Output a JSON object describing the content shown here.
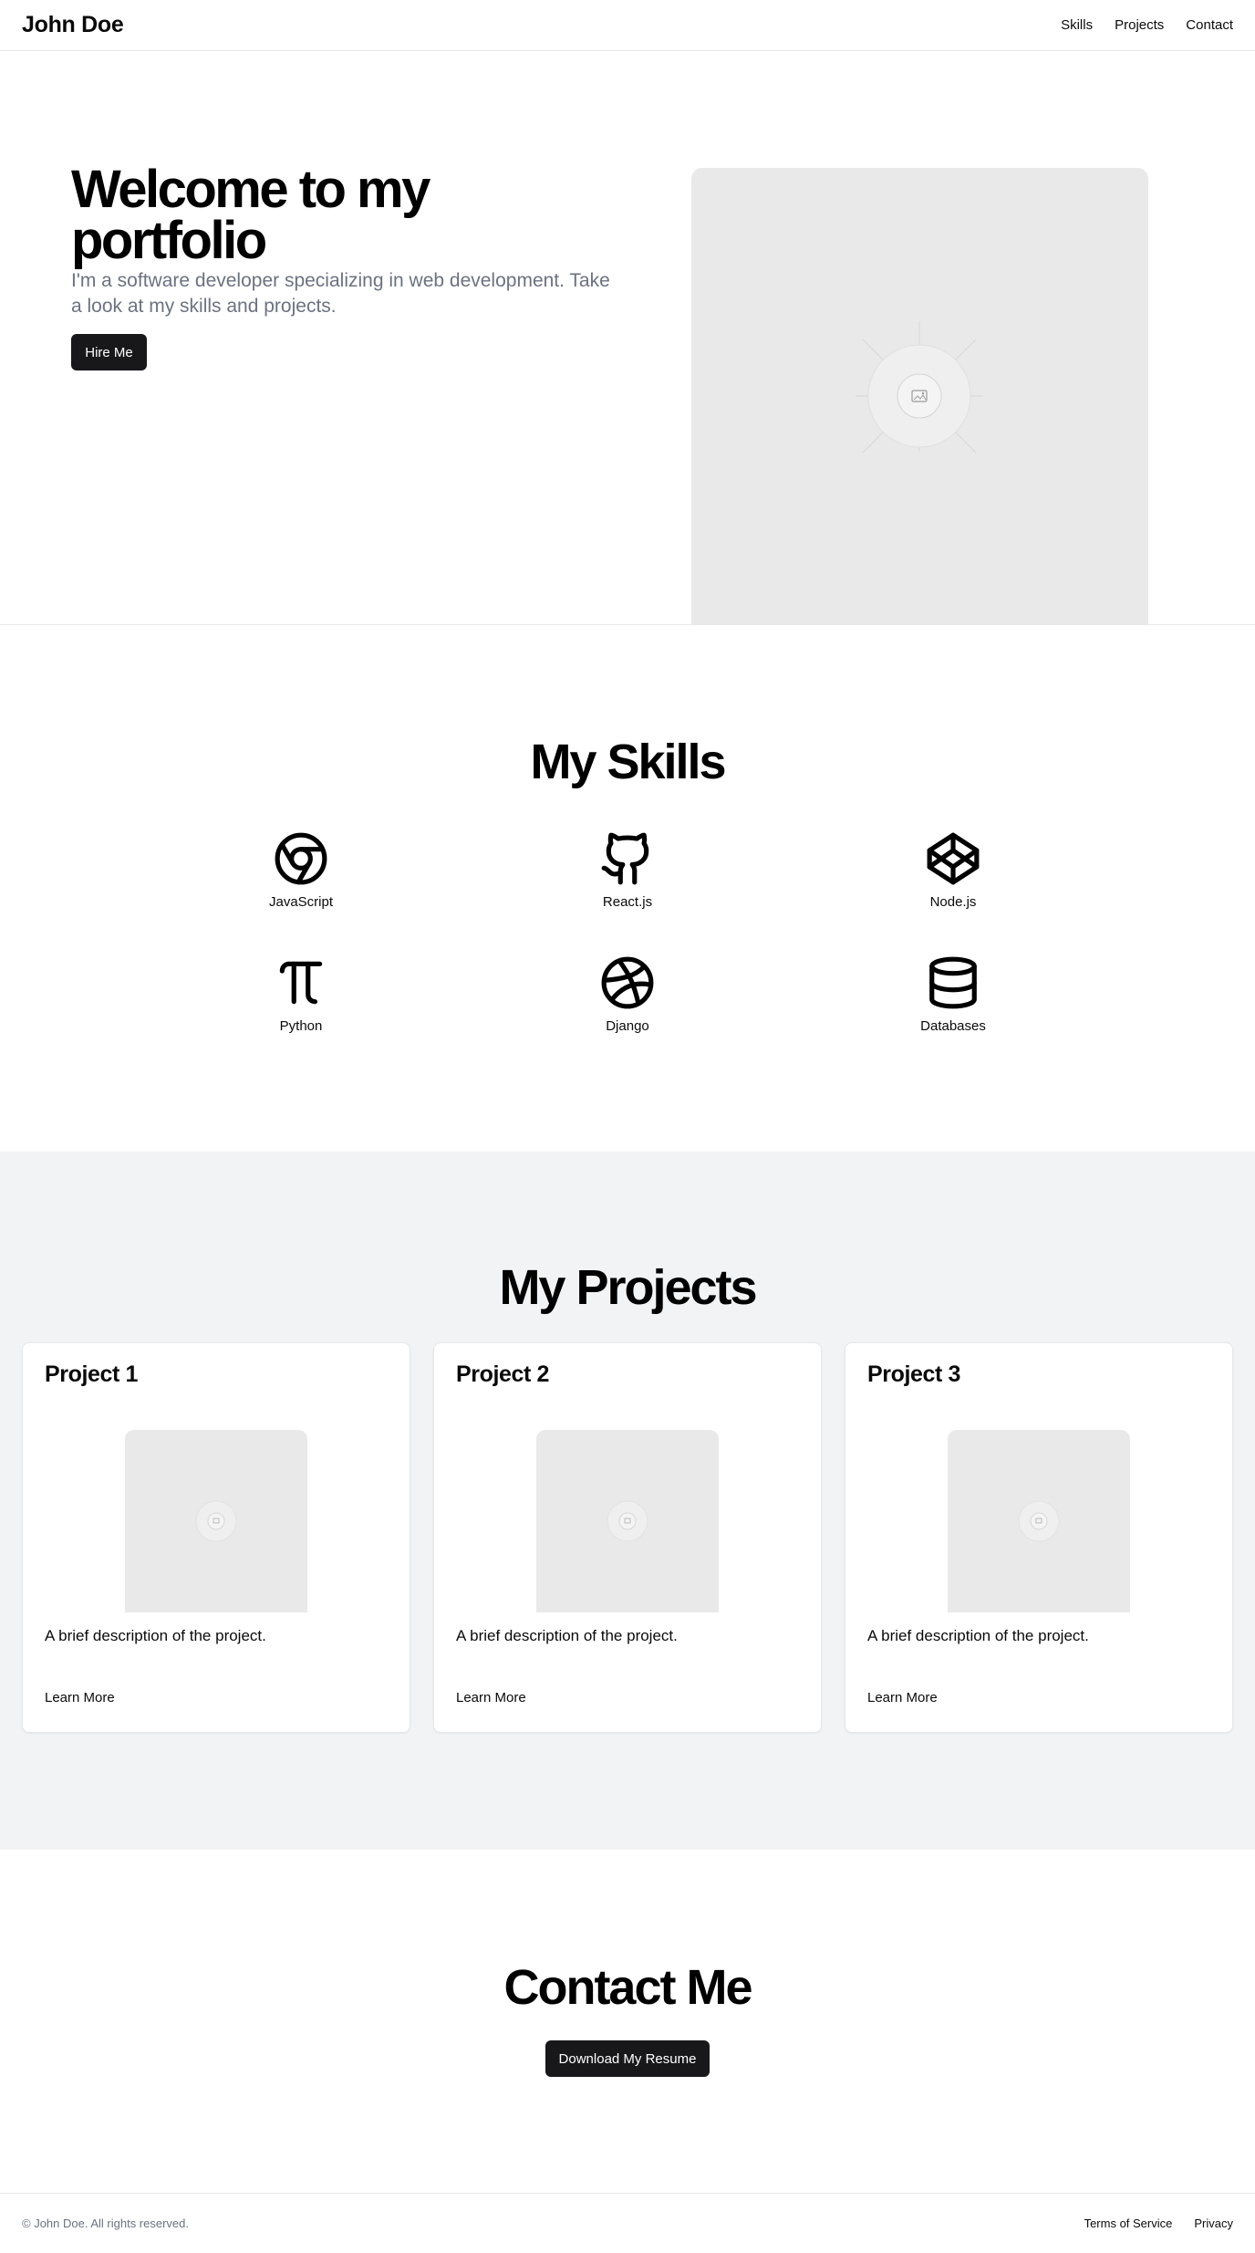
{
  "header": {
    "brand": "John Doe",
    "nav": [
      "Skills",
      "Projects",
      "Contact"
    ]
  },
  "hero": {
    "title": "Welcome to my portfolio",
    "subtitle": "I'm a software developer specializing in web development. Take a look at my skills and projects.",
    "cta_label": "Hire Me",
    "image_icon": "image-placeholder-icon"
  },
  "skills": {
    "title": "My Skills",
    "items": [
      {
        "label": "JavaScript",
        "icon": "chrome-icon"
      },
      {
        "label": "React.js",
        "icon": "github-icon"
      },
      {
        "label": "Node.js",
        "icon": "codepen-icon"
      },
      {
        "label": "Python",
        "icon": "pi-icon"
      },
      {
        "label": "Django",
        "icon": "dribbble-icon"
      },
      {
        "label": "Databases",
        "icon": "database-icon"
      }
    ]
  },
  "projects": {
    "title": "My Projects",
    "items": [
      {
        "title": "Project 1",
        "description": "A brief description of the project.",
        "link_label": "Learn More"
      },
      {
        "title": "Project 2",
        "description": "A brief description of the project.",
        "link_label": "Learn More"
      },
      {
        "title": "Project 3",
        "description": "A brief description of the project.",
        "link_label": "Learn More"
      }
    ]
  },
  "contact": {
    "title": "Contact Me",
    "resume_label": "Download My Resume"
  },
  "footer": {
    "copyright": "© John Doe. All rights reserved.",
    "links": [
      "Terms of Service",
      "Privacy"
    ]
  },
  "colors": {
    "primary_button": "#18181b",
    "muted_text": "#6b7280",
    "projects_background": "#f2f3f5",
    "placeholder": "#e9e9e9"
  }
}
